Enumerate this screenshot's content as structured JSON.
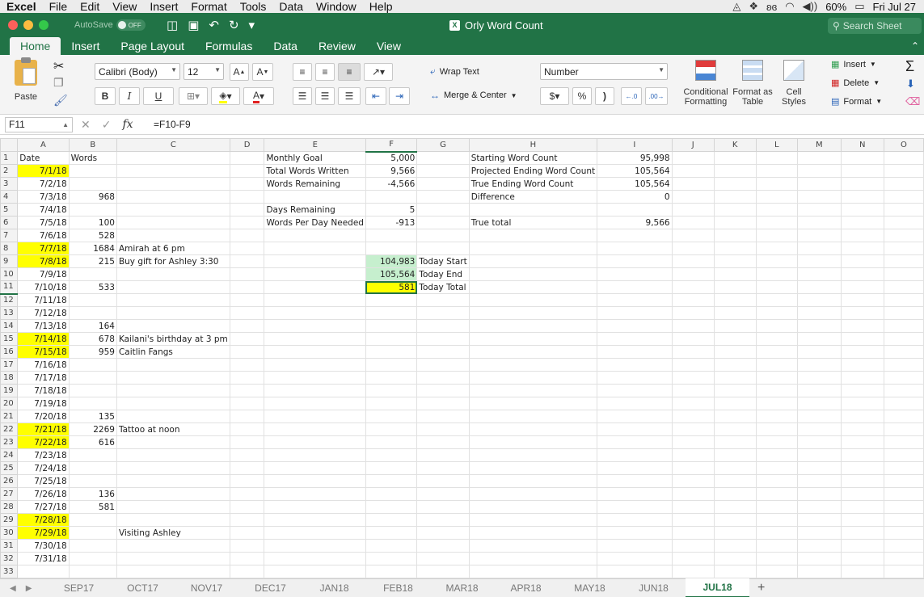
{
  "menubar": {
    "app": "Excel",
    "items": [
      "File",
      "Edit",
      "View",
      "Insert",
      "Format",
      "Tools",
      "Data",
      "Window",
      "Help"
    ],
    "battery": "60%",
    "clock": "Fri Jul 27"
  },
  "titlebar": {
    "autosave_label": "AutoSave",
    "autosave_state": "OFF",
    "title": "Orly Word Count",
    "search_placeholder": "Search Sheet"
  },
  "ribbon_tabs": [
    "Home",
    "Insert",
    "Page Layout",
    "Formulas",
    "Data",
    "Review",
    "View"
  ],
  "ribbon": {
    "paste": "Paste",
    "font_name": "Calibri (Body)",
    "font_size": "12",
    "bold": "B",
    "italic": "I",
    "underline": "U",
    "wrap_text": "Wrap Text",
    "merge_center": "Merge & Center",
    "number_format": "Number",
    "currency": "$",
    "percent": "%",
    "comma": ")",
    "conditional_formatting": "Conditional Formatting",
    "format_as_table": "Format as Table",
    "cell_styles": "Cell Styles",
    "insert": "Insert",
    "delete": "Delete",
    "format": "Format"
  },
  "formula_bar": {
    "name_box": "F11",
    "formula": "=F10-F9"
  },
  "columns": [
    "A",
    "B",
    "C",
    "D",
    "E",
    "F",
    "G",
    "H",
    "I",
    "J",
    "K",
    "L",
    "M",
    "N",
    "O"
  ],
  "rows": [
    {
      "n": "1",
      "A": "Date",
      "B": "Words",
      "C": "",
      "E": "Monthly Goal",
      "F": "5,000",
      "G": "",
      "H": "Starting Word Count",
      "I": "95,998"
    },
    {
      "n": "2",
      "A": "7/1/18",
      "B": "",
      "C": "",
      "E": "Total Words Written",
      "F": "9,566",
      "G": "",
      "H": "Projected Ending Word Count",
      "I": "105,564"
    },
    {
      "n": "3",
      "A": "7/2/18",
      "B": "",
      "C": "",
      "E": "Words Remaining",
      "F": "-4,566",
      "G": "",
      "H": "True Ending Word Count",
      "I": "105,564"
    },
    {
      "n": "4",
      "A": "7/3/18",
      "B": "968",
      "C": "",
      "E": "",
      "F": "",
      "G": "",
      "H": "Difference",
      "I": "0"
    },
    {
      "n": "5",
      "A": "7/4/18",
      "B": "",
      "C": "",
      "E": "Days Remaining",
      "F": "5",
      "G": "",
      "H": "",
      "I": ""
    },
    {
      "n": "6",
      "A": "7/5/18",
      "B": "100",
      "C": "",
      "E": "Words Per Day Needed",
      "F": "-913",
      "G": "",
      "H": "True total",
      "I": "9,566"
    },
    {
      "n": "7",
      "A": "7/6/18",
      "B": "528",
      "C": "",
      "E": "",
      "F": "",
      "G": "",
      "H": "",
      "I": ""
    },
    {
      "n": "8",
      "A": "7/7/18",
      "B": "1684",
      "C": "Amirah at 6 pm",
      "E": "",
      "F": "",
      "G": "",
      "H": "",
      "I": ""
    },
    {
      "n": "9",
      "A": "7/8/18",
      "B": "215",
      "C": "Buy gift for Ashley 3:30",
      "E": "",
      "F": "104,983",
      "G": "Today Start",
      "H": "",
      "I": ""
    },
    {
      "n": "10",
      "A": "7/9/18",
      "B": "",
      "C": "",
      "E": "",
      "F": "105,564",
      "G": "Today End",
      "H": "",
      "I": ""
    },
    {
      "n": "11",
      "A": "7/10/18",
      "B": "533",
      "C": "",
      "E": "",
      "F": "581",
      "G": "Today Total",
      "H": "",
      "I": ""
    },
    {
      "n": "12",
      "A": "7/11/18",
      "B": "",
      "C": "",
      "E": "",
      "F": "",
      "G": "",
      "H": "",
      "I": ""
    },
    {
      "n": "13",
      "A": "7/12/18",
      "B": "",
      "C": "",
      "E": "",
      "F": "",
      "G": "",
      "H": "",
      "I": ""
    },
    {
      "n": "14",
      "A": "7/13/18",
      "B": "164",
      "C": "",
      "E": "",
      "F": "",
      "G": "",
      "H": "",
      "I": ""
    },
    {
      "n": "15",
      "A": "7/14/18",
      "B": "678",
      "C": "Kailani's birthday at 3 pm",
      "E": "",
      "F": "",
      "G": "",
      "H": "",
      "I": ""
    },
    {
      "n": "16",
      "A": "7/15/18",
      "B": "959",
      "C": "Caitlin Fangs",
      "E": "",
      "F": "",
      "G": "",
      "H": "",
      "I": ""
    },
    {
      "n": "17",
      "A": "7/16/18",
      "B": "",
      "C": "",
      "E": "",
      "F": "",
      "G": "",
      "H": "",
      "I": ""
    },
    {
      "n": "18",
      "A": "7/17/18",
      "B": "",
      "C": "",
      "E": "",
      "F": "",
      "G": "",
      "H": "",
      "I": ""
    },
    {
      "n": "19",
      "A": "7/18/18",
      "B": "",
      "C": "",
      "E": "",
      "F": "",
      "G": "",
      "H": "",
      "I": ""
    },
    {
      "n": "20",
      "A": "7/19/18",
      "B": "",
      "C": "",
      "E": "",
      "F": "",
      "G": "",
      "H": "",
      "I": ""
    },
    {
      "n": "21",
      "A": "7/20/18",
      "B": "135",
      "C": "",
      "E": "",
      "F": "",
      "G": "",
      "H": "",
      "I": ""
    },
    {
      "n": "22",
      "A": "7/21/18",
      "B": "2269",
      "C": "Tattoo at noon",
      "E": "",
      "F": "",
      "G": "",
      "H": "",
      "I": ""
    },
    {
      "n": "23",
      "A": "7/22/18",
      "B": "616",
      "C": "",
      "E": "",
      "F": "",
      "G": "",
      "H": "",
      "I": ""
    },
    {
      "n": "24",
      "A": "7/23/18",
      "B": "",
      "C": "",
      "E": "",
      "F": "",
      "G": "",
      "H": "",
      "I": ""
    },
    {
      "n": "25",
      "A": "7/24/18",
      "B": "",
      "C": "",
      "E": "",
      "F": "",
      "G": "",
      "H": "",
      "I": ""
    },
    {
      "n": "26",
      "A": "7/25/18",
      "B": "",
      "C": "",
      "E": "",
      "F": "",
      "G": "",
      "H": "",
      "I": ""
    },
    {
      "n": "27",
      "A": "7/26/18",
      "B": "136",
      "C": "",
      "E": "",
      "F": "",
      "G": "",
      "H": "",
      "I": ""
    },
    {
      "n": "28",
      "A": "7/27/18",
      "B": "581",
      "C": "",
      "E": "",
      "F": "",
      "G": "",
      "H": "",
      "I": ""
    },
    {
      "n": "29",
      "A": "7/28/18",
      "B": "",
      "C": "",
      "E": "",
      "F": "",
      "G": "",
      "H": "",
      "I": ""
    },
    {
      "n": "30",
      "A": "7/29/18",
      "B": "",
      "C": "Visiting Ashley",
      "E": "",
      "F": "",
      "G": "",
      "H": "",
      "I": ""
    },
    {
      "n": "31",
      "A": "7/30/18",
      "B": "",
      "C": "",
      "E": "",
      "F": "",
      "G": "",
      "H": "",
      "I": ""
    },
    {
      "n": "32",
      "A": "7/31/18",
      "B": "",
      "C": "",
      "E": "",
      "F": "",
      "G": "",
      "H": "",
      "I": ""
    },
    {
      "n": "33",
      "A": "",
      "B": "",
      "C": "",
      "E": "",
      "F": "",
      "G": "",
      "H": "",
      "I": ""
    }
  ],
  "highlight_dates": [
    "2",
    "8",
    "9",
    "15",
    "16",
    "22",
    "23",
    "29",
    "30"
  ],
  "sheet_tabs": [
    "SEP17",
    "OCT17",
    "NOV17",
    "DEC17",
    "JAN18",
    "FEB18",
    "MAR18",
    "APR18",
    "MAY18",
    "JUN18",
    "JUL18"
  ],
  "active_sheet": "JUL18",
  "colors": {
    "excel_green": "#217346",
    "date_highlight": "#ffff00",
    "today_fill": "#c6efce"
  }
}
